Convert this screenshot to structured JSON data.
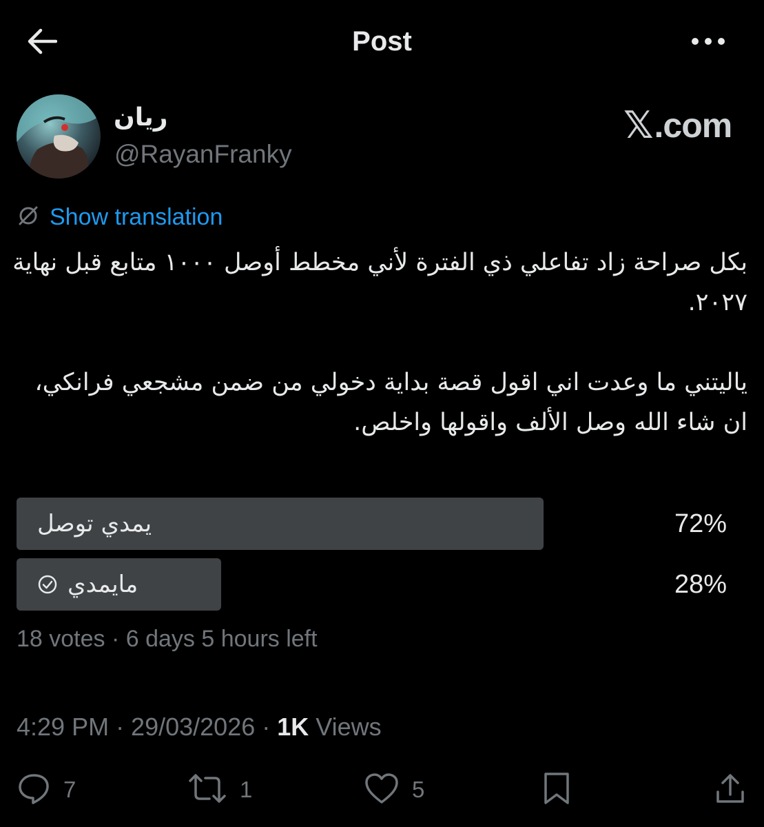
{
  "header": {
    "title": "Post"
  },
  "author": {
    "display_name": "ريان",
    "handle": "@RayanFranky"
  },
  "watermark": {
    "x_glyph": "𝕏",
    "text": ".com"
  },
  "translation": {
    "label": "Show translation"
  },
  "tweet": {
    "paragraph1": "بكل صراحة زاد تفاعلي ذي الفترة لأني مخطط أوصل ١٠٠٠ متابع قبل نهاية ٢٠٢٧.",
    "paragraph2": "ياليتني ما وعدت اني اقول قصة بداية دخولي من ضمن مشجعي فرانكي، ان شاء الله وصل الألف واقولها واخلص."
  },
  "poll": {
    "options": [
      {
        "label": "يمدي توصل",
        "percent_text": "72%",
        "fraction": 0.72,
        "selected": false
      },
      {
        "label": "مايمدي",
        "percent_text": "28%",
        "fraction": 0.28,
        "selected": true
      }
    ],
    "meta": "18 votes · 6 days 5 hours left"
  },
  "timestamp": {
    "time_date": "4:29 PM · 29/03/2026 · ",
    "views_count": "1K",
    "views_label": " Views"
  },
  "actions": {
    "replies": "7",
    "reposts": "1",
    "likes": "5"
  },
  "colors": {
    "background": "#000000",
    "text_primary": "#e7e9ea",
    "text_secondary": "#71767b",
    "link": "#1d9bf0",
    "poll_bar": "#3f4346"
  },
  "icons": {
    "back": "arrow-left-icon",
    "more": "more-dots-icon",
    "translate": "globe-slash-icon",
    "check": "check-circle-icon",
    "reply": "reply-icon",
    "repost": "repost-icon",
    "like": "heart-icon",
    "bookmark": "bookmark-icon",
    "share": "share-icon"
  }
}
